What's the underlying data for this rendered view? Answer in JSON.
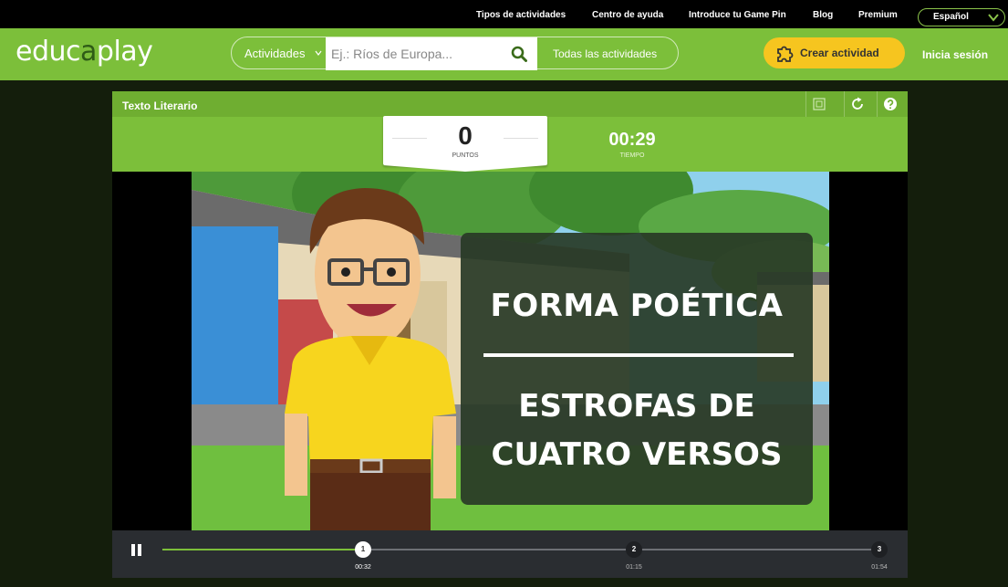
{
  "topbar": {
    "links": [
      "Tipos de actividades",
      "Centro de ayuda",
      "Introduce tu Game Pin",
      "Blog",
      "Premium"
    ],
    "language": "Español"
  },
  "header": {
    "logo": {
      "part1": "educ",
      "part2": "a",
      "part3": "play"
    },
    "search": {
      "category": "Actividades",
      "placeholder": "Ej.: Ríos de Europa...",
      "all_label": "Todas las actividades"
    },
    "create_label": "Crear actividad",
    "login_label": "Inicia sesión"
  },
  "game": {
    "title": "Texto Literario",
    "score": {
      "value": "0",
      "label": "PUNTOS"
    },
    "timer": {
      "value": "00:29",
      "label": "TIEMPO"
    },
    "tools": [
      "fullscreen-icon",
      "restart-icon",
      "help-icon"
    ],
    "video": {
      "title_line1": "FORMA POÉTICA",
      "title_line2": "ESTROFAS DE",
      "title_line3": "CUATRO VERSOS"
    },
    "controls": {
      "progress": 0.28,
      "markers": [
        {
          "number": "1",
          "time": "00:32",
          "active": true
        },
        {
          "number": "2",
          "time": "01:15",
          "active": false
        },
        {
          "number": "3",
          "time": "01:54",
          "active": false
        }
      ]
    }
  },
  "colors": {
    "brand_green": "#7cbf3a",
    "accent_yellow": "#f6c51f",
    "background": "#141e0c"
  }
}
